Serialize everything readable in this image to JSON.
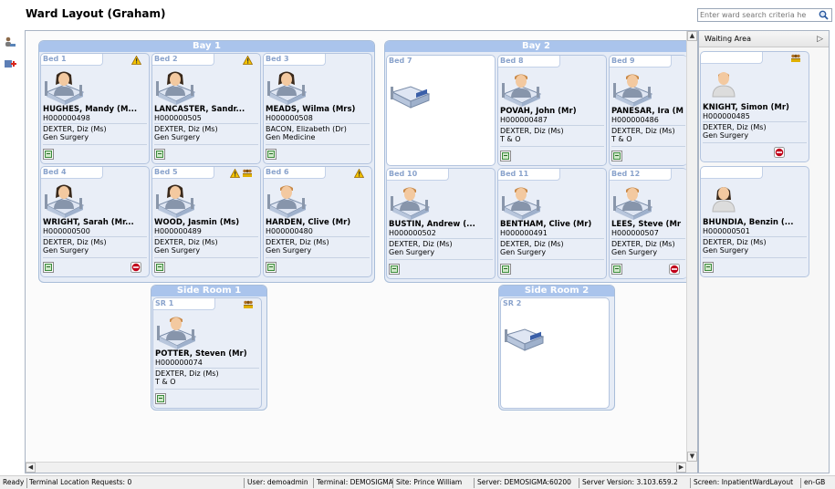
{
  "title": "Ward Layout (Graham)",
  "search": {
    "placeholder": "Enter ward search criteria he"
  },
  "left_tools": [
    "people-icon",
    "add-patient-icon"
  ],
  "bays": [
    {
      "label": "Bay 1"
    },
    {
      "label": "Bay 2"
    },
    {
      "label": "Side Room 1"
    },
    {
      "label": "Side Room 2"
    }
  ],
  "beds": [
    {
      "id": "Bed 1",
      "name": "HUGHES, Mandy  (M...",
      "hid": "H000000498",
      "cons": "DEXTER, Diz (Ms)",
      "spec": "Gen Surgery",
      "gender": "female",
      "flags": [
        "alert"
      ],
      "stop": false
    },
    {
      "id": "Bed 2",
      "name": "LANCASTER, Sandr...",
      "hid": "H000000505",
      "cons": "DEXTER, Diz (Ms)",
      "spec": "Gen Surgery",
      "gender": "female",
      "flags": [
        "alert"
      ],
      "stop": false
    },
    {
      "id": "Bed 3",
      "name": "MEADS, Wilma (Mrs)",
      "hid": "H000000508",
      "cons": "BACON, Elizabeth (Dr)",
      "spec": "Gen Medicine",
      "gender": "female",
      "flags": [],
      "stop": false
    },
    {
      "id": "Bed 4",
      "name": "WRIGHT, Sarah  (Mr...",
      "hid": "H000000500",
      "cons": "DEXTER, Diz (Ms)",
      "spec": "Gen Surgery",
      "gender": "female",
      "flags": [],
      "stop": true
    },
    {
      "id": "Bed 5",
      "name": "WOOD, Jasmin (Ms)",
      "hid": "H000000489",
      "cons": "DEXTER, Diz (Ms)",
      "spec": "Gen Surgery",
      "gender": "female",
      "flags": [
        "alert",
        "group"
      ],
      "stop": false
    },
    {
      "id": "Bed 6",
      "name": "HARDEN, Clive (Mr)",
      "hid": "H000000480",
      "cons": "DEXTER, Diz (Ms)",
      "spec": "Gen Surgery",
      "gender": "male",
      "flags": [
        "alert"
      ],
      "stop": false
    },
    {
      "id": "Bed 7",
      "name": "",
      "hid": "",
      "cons": "",
      "spec": "",
      "gender": "",
      "flags": [],
      "stop": false
    },
    {
      "id": "Bed 8",
      "name": "POVAH, John (Mr)",
      "hid": "H000000487",
      "cons": "DEXTER, Diz (Ms)",
      "spec": "T & O",
      "gender": "male",
      "flags": [],
      "stop": false
    },
    {
      "id": "Bed 9",
      "name": "PANESAR, Ira (M",
      "hid": "H000000486",
      "cons": "DEXTER, Diz (Ms)",
      "spec": "T & O",
      "gender": "male",
      "flags": [],
      "stop": false
    },
    {
      "id": "Bed 10",
      "name": "BUSTIN, Andrew  (...",
      "hid": "H000000502",
      "cons": "DEXTER, Diz (Ms)",
      "spec": "Gen Surgery",
      "gender": "male",
      "flags": [],
      "stop": false
    },
    {
      "id": "Bed 11",
      "name": "BENTHAM, Clive (Mr)",
      "hid": "H000000491",
      "cons": "DEXTER, Diz (Ms)",
      "spec": "Gen Surgery",
      "gender": "male",
      "flags": [],
      "stop": false
    },
    {
      "id": "Bed 12",
      "name": "LEES, Steve (Mr",
      "hid": "H000000507",
      "cons": "DEXTER, Diz (Ms)",
      "spec": "Gen Surgery",
      "gender": "male",
      "flags": [],
      "stop": true
    },
    {
      "id": "SR 1",
      "name": "POTTER, Steven (Mr)",
      "hid": "H000000074",
      "cons": "DEXTER, Diz (Ms)",
      "spec": "T & O",
      "gender": "male",
      "flags": [
        "group"
      ],
      "stop": false
    },
    {
      "id": "SR 2",
      "name": "",
      "hid": "",
      "cons": "",
      "spec": "",
      "gender": "",
      "flags": [],
      "stop": false
    }
  ],
  "waiting": {
    "label": "Waiting Area",
    "patients": [
      {
        "name": "KNIGHT, Simon (Mr)",
        "hid": "H000000485",
        "cons": "DEXTER, Diz (Ms)",
        "spec": "Gen Surgery",
        "gender": "male",
        "flags": [
          "group"
        ],
        "stop": true
      },
      {
        "name": "BHUNDIA,  Benzin  (...",
        "hid": "H000000501",
        "cons": "DEXTER, Diz (Ms)",
        "spec": "Gen Surgery",
        "gender": "female",
        "flags": [],
        "stop": false
      }
    ]
  },
  "status": {
    "ready": "Ready",
    "requests": "Terminal Location Requests: 0",
    "user": "User: demoadmin",
    "terminal": "Terminal: DEMOSIGMA",
    "site": "Site: Prince William",
    "server": "Server: DEMOSIGMA:60200",
    "version": "Server Version: 3.103.659.2",
    "screen": "Screen: InpatientWardLayout",
    "locale": "en-GB"
  },
  "colors": {
    "bay_header": "#aac4ec",
    "bed_bg": "#e9eef7",
    "bed_label": "#8aa3cc",
    "stop": "#c0001a",
    "alert": "#f0b400"
  }
}
